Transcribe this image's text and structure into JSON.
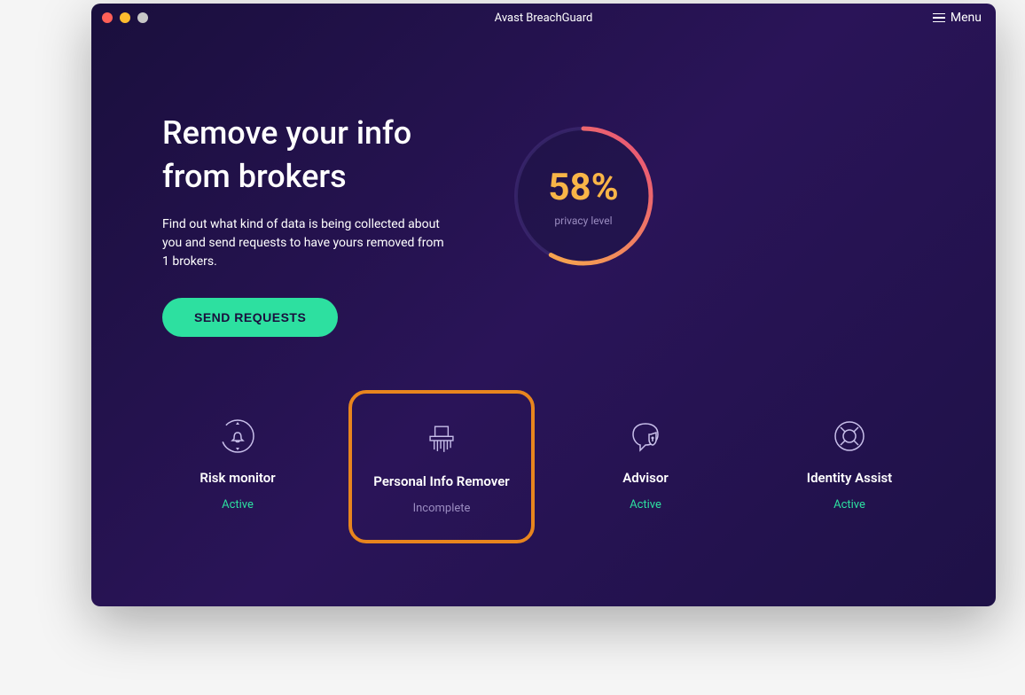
{
  "window": {
    "title": "Avast BreachGuard",
    "menu_label": "Menu"
  },
  "hero": {
    "title": "Remove your info from brokers",
    "description": "Find out what kind of data is being collected about you and send requests to have yours removed from 1 brokers.",
    "cta_label": "SEND REQUESTS"
  },
  "gauge": {
    "value": "58%",
    "label": "privacy level",
    "percent": 58
  },
  "features": [
    {
      "id": "risk-monitor",
      "title": "Risk monitor",
      "status": "Active",
      "status_type": "active",
      "highlighted": false
    },
    {
      "id": "personal-info-remover",
      "title": "Personal Info Remover",
      "status": "Incomplete",
      "status_type": "incomplete",
      "highlighted": true
    },
    {
      "id": "advisor",
      "title": "Advisor",
      "status": "Active",
      "status_type": "active",
      "highlighted": false
    },
    {
      "id": "identity-assist",
      "title": "Identity Assist",
      "status": "Active",
      "status_type": "active",
      "highlighted": false
    }
  ]
}
